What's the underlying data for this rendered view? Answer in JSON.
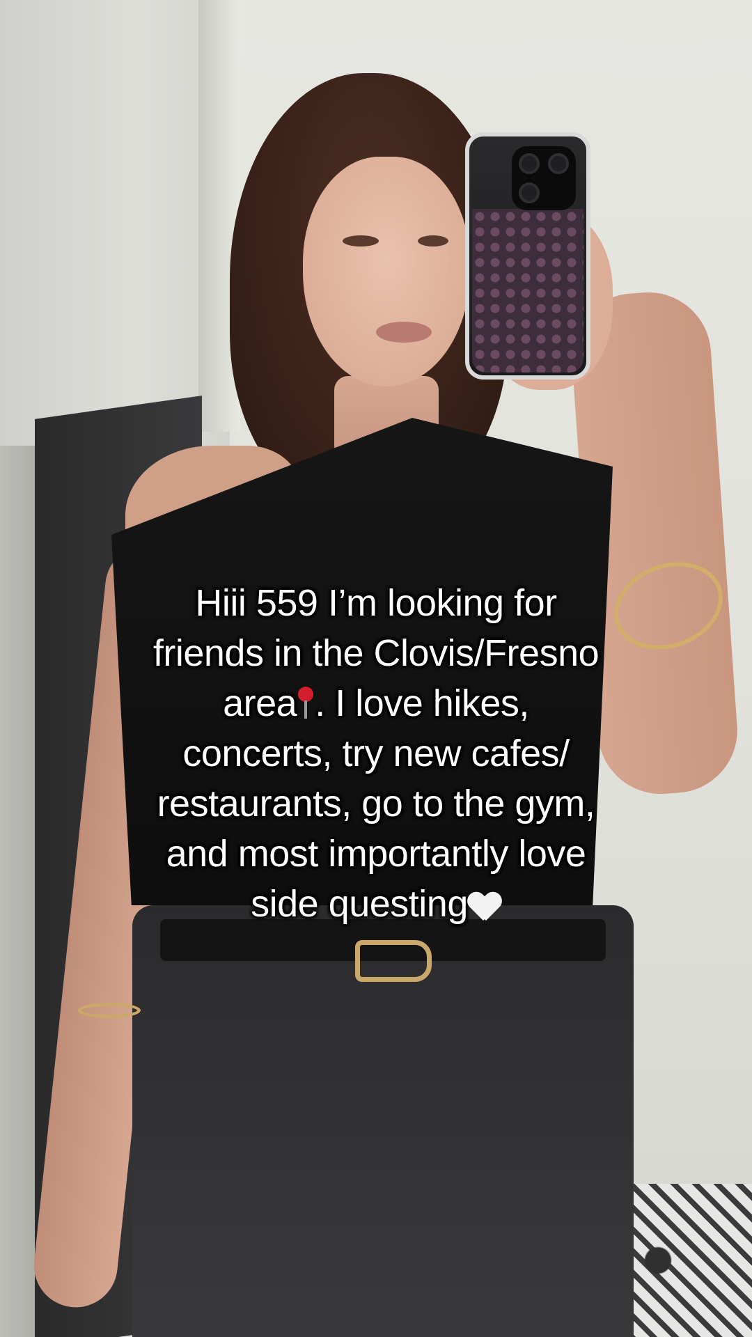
{
  "caption": {
    "line1": "Hiii 559 I’m looking for",
    "line2": "friends in the Clovis/Fresno",
    "line3_a": "area",
    "line3_b": ". I love hikes,",
    "line4": "concerts, try new cafes/",
    "line5": "restaurants, go to the gym,",
    "line6": "and most importantly love",
    "line7": "side questing",
    "icons": [
      "round-pushpin-icon",
      "white-heart-icon"
    ]
  },
  "colors": {
    "caption_text": "#ffffff",
    "pin_red": "#d21f2b"
  }
}
